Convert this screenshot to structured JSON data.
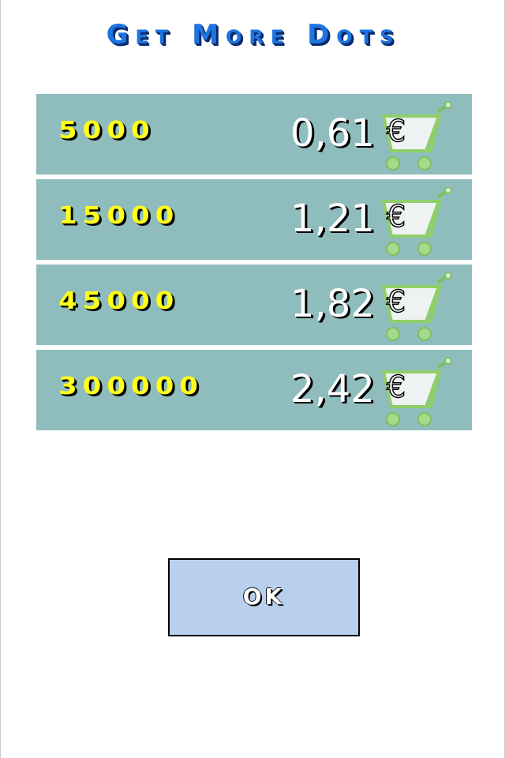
{
  "title": "Get More Dots",
  "offers": [
    {
      "amount": "5000",
      "price": "0,61",
      "currency": "€",
      "icon": "shopping-cart-icon"
    },
    {
      "amount": "15000",
      "price": "1,21",
      "currency": "€",
      "icon": "shopping-cart-icon"
    },
    {
      "amount": "45000",
      "price": "1,82",
      "currency": "€",
      "icon": "shopping-cart-icon"
    },
    {
      "amount": "300000",
      "price": "2,42",
      "currency": "€",
      "icon": "shopping-cart-icon"
    }
  ],
  "ok_label": "OK",
  "colors": {
    "title": "#1e74e0",
    "row_background": "#8fbcbc",
    "amount_text": "#ffff1a",
    "price_text": "#ffffff",
    "cart_green": "#8fcf6a",
    "ok_background": "#b8d0ec"
  }
}
